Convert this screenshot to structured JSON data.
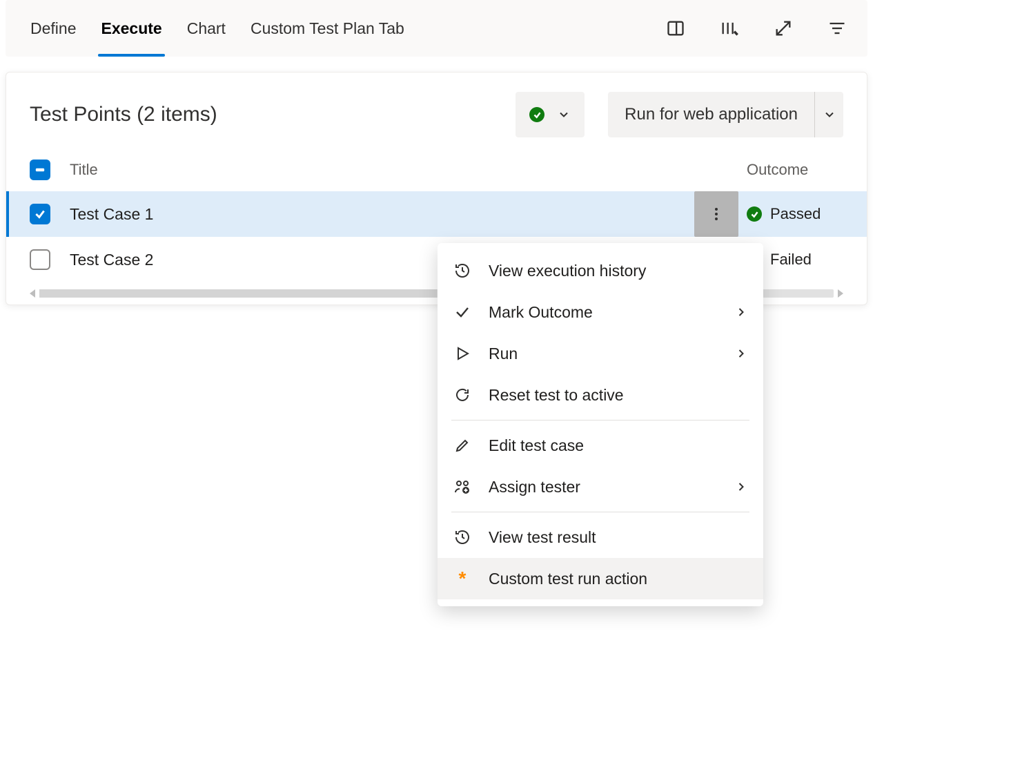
{
  "tabs": {
    "define": "Define",
    "execute": "Execute",
    "chart": "Chart",
    "custom": "Custom Test Plan Tab"
  },
  "panel": {
    "title": "Test Points (2 items)",
    "run_label": "Run for web application"
  },
  "columns": {
    "title": "Title",
    "outcome": "Outcome"
  },
  "rows": [
    {
      "title": "Test Case 1",
      "outcome": "Passed"
    },
    {
      "title": "Test Case 2",
      "outcome": "Failed"
    }
  ],
  "menu": {
    "history": "View execution history",
    "mark": "Mark Outcome",
    "run": "Run",
    "reset": "Reset test to active",
    "edit": "Edit test case",
    "assign": "Assign tester",
    "result": "View test result",
    "custom": "Custom test run action"
  }
}
